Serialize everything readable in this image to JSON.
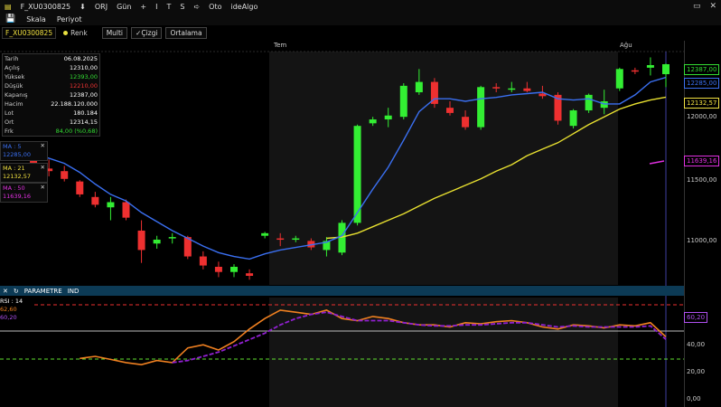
{
  "titlebar": {
    "symbol": "F_XU0300825",
    "buttons": [
      "ORJ",
      "Gün",
      "+",
      "I",
      "T",
      "S",
      "Oto",
      "ideAlgo"
    ],
    "arrow_down": "⬇",
    "arrow_right": "➪"
  },
  "menubar": {
    "items": [
      "Skala",
      "Periyot"
    ]
  },
  "toolbar": {
    "symbol": "F_XU0300825",
    "renk": "Renk",
    "multi": "Multi",
    "cizgi": "Çizgi",
    "ortalama": "Ortalama"
  },
  "timeaxis": {
    "tem": "Tem",
    "agu": "Ağu"
  },
  "info": {
    "rows": [
      {
        "k": "Tarih",
        "v": "06.08.2025",
        "color": "#ffffff"
      },
      {
        "k": "Açılış",
        "v": "12310,00",
        "color": "#ffffff"
      },
      {
        "k": "Yüksek",
        "v": "12393,00",
        "color": "#33dd33"
      },
      {
        "k": "Düşük",
        "v": "12210,00",
        "color": "#ee3333"
      },
      {
        "k": "Kapanış",
        "v": "12387,00",
        "color": "#ffffff"
      },
      {
        "k": "Hacim",
        "v": "22.188.120.000",
        "color": "#ffffff"
      },
      {
        "k": "Lot",
        "v": "180.184",
        "color": "#ffffff"
      },
      {
        "k": "Ort",
        "v": "12314,15",
        "color": "#ffffff"
      },
      {
        "k": "Frk",
        "v": "84,00 (%0,68)",
        "color": "#33dd33"
      }
    ]
  },
  "ma": [
    {
      "label": "MA : 5",
      "value": "12285,00",
      "color": "#3a6ff0"
    },
    {
      "label": "MA : 21",
      "value": "12132,57",
      "color": "#f0e040"
    },
    {
      "label": "MA : 50",
      "value": "11639,16",
      "color": "#e030e0"
    }
  ],
  "panelbar": {
    "parametre": "PARAMETRE",
    "ind": "IND"
  },
  "rsi": {
    "label": "RSI : 14",
    "v1": "62,60",
    "v2": "60,20"
  },
  "price_axis": [
    "12000,00",
    "11500,00",
    "11000,00"
  ],
  "rsi_axis": [
    "40,00",
    "20,00",
    "0,00"
  ],
  "price_tags": [
    {
      "text": "12387,00",
      "color": "#33dd33"
    },
    {
      "text": "12285,00",
      "color": "#3a6ff0"
    },
    {
      "text": "12132,57",
      "color": "#f0e040"
    },
    {
      "text": "11639,16",
      "color": "#e030e0"
    }
  ],
  "rsi_tag": "60,20",
  "chart_data": {
    "type": "candlestick",
    "x": [
      "d1",
      "d2",
      "d3",
      "d4",
      "d5",
      "d6",
      "d7",
      "d8",
      "d9",
      "d10",
      "d11",
      "d12",
      "d13",
      "d14",
      "d15",
      "d16",
      "d17",
      "d18",
      "d19",
      "d20",
      "d21",
      "d22",
      "d23",
      "d24",
      "d25",
      "d26",
      "d27",
      "d28",
      "d29",
      "d30",
      "d31",
      "d32",
      "d33",
      "d34",
      "d35",
      "d36",
      "d37",
      "d38",
      "d39",
      "d40",
      "d41",
      "d42",
      "d43"
    ],
    "ohlc": [
      [
        11700,
        11760,
        11650,
        11720
      ],
      [
        11680,
        11720,
        11560,
        11580
      ],
      [
        11580,
        11650,
        11520,
        11560
      ],
      [
        11560,
        11600,
        11480,
        11500
      ],
      [
        11480,
        11490,
        11360,
        11380
      ],
      [
        11360,
        11400,
        11280,
        11300
      ],
      [
        11280,
        11360,
        11180,
        11320
      ],
      [
        11320,
        11340,
        11180,
        11200
      ],
      [
        11100,
        11180,
        10850,
        10950
      ],
      [
        11000,
        11060,
        10960,
        11030
      ],
      [
        11040,
        11080,
        11000,
        11050
      ],
      [
        11050,
        11060,
        10880,
        10900
      ],
      [
        10900,
        10940,
        10800,
        10830
      ],
      [
        10820,
        10860,
        10740,
        10780
      ],
      [
        10780,
        10840,
        10740,
        10820
      ],
      [
        10770,
        10800,
        10720,
        10750
      ],
      [
        11060,
        11090,
        11040,
        11080
      ],
      [
        11040,
        11080,
        10980,
        11030
      ],
      [
        11030,
        11060,
        11010,
        11040
      ],
      [
        11020,
        11040,
        10950,
        10970
      ],
      [
        10950,
        11050,
        10900,
        11020
      ],
      [
        10930,
        11180,
        10910,
        11160
      ],
      [
        11160,
        11920,
        11140,
        11910
      ],
      [
        11930,
        11980,
        11910,
        11960
      ],
      [
        11960,
        12050,
        11900,
        11990
      ],
      [
        11980,
        12240,
        11960,
        12220
      ],
      [
        12170,
        12350,
        12150,
        12250
      ],
      [
        12250,
        12280,
        12050,
        12080
      ],
      [
        12050,
        12100,
        11990,
        12010
      ],
      [
        11980,
        12030,
        11880,
        11900
      ],
      [
        11900,
        12220,
        11880,
        12210
      ],
      [
        12210,
        12240,
        12170,
        12200
      ],
      [
        12200,
        12250,
        12170,
        12200
      ],
      [
        12200,
        12250,
        12170,
        12180
      ],
      [
        12160,
        12220,
        12120,
        12140
      ],
      [
        12150,
        12170,
        11920,
        11950
      ],
      [
        11910,
        12040,
        11890,
        12030
      ],
      [
        12030,
        12160,
        12010,
        12150
      ],
      [
        12050,
        12190,
        12000,
        12100
      ],
      [
        12200,
        12360,
        12180,
        12350
      ],
      [
        12340,
        12360,
        12310,
        12330
      ],
      [
        12360,
        12440,
        12300,
        12380
      ],
      [
        12310,
        12393,
        12210,
        12387
      ]
    ],
    "ma5": [
      11700,
      11690,
      11660,
      11620,
      11550,
      11460,
      11380,
      11330,
      11240,
      11170,
      11100,
      11040,
      10980,
      10930,
      10900,
      10880,
      10920,
      10950,
      10970,
      10990,
      11010,
      11060,
      11240,
      11420,
      11590,
      11800,
      12020,
      12120,
      12120,
      12100,
      12120,
      12130,
      12150,
      12160,
      12170,
      12120,
      12110,
      12120,
      12080,
      12080,
      12150,
      12250,
      12285
    ],
    "ma21": [
      null,
      null,
      null,
      null,
      null,
      null,
      null,
      null,
      null,
      null,
      null,
      null,
      null,
      null,
      null,
      null,
      null,
      null,
      null,
      null,
      11040,
      11050,
      11080,
      11130,
      11180,
      11230,
      11290,
      11350,
      11400,
      11450,
      11500,
      11560,
      11610,
      11680,
      11730,
      11780,
      11850,
      11920,
      11980,
      12040,
      12080,
      12110,
      12132.57
    ],
    "rsi14": [
      null,
      null,
      null,
      null,
      null,
      null,
      null,
      null,
      null,
      null,
      null,
      null,
      null,
      null,
      null,
      null,
      null,
      null,
      null,
      null,
      null,
      null,
      null,
      null,
      null,
      null,
      null,
      null,
      null,
      null,
      null,
      null,
      null,
      null,
      null,
      null,
      null,
      null,
      null,
      null,
      null,
      null,
      62.6
    ],
    "rsi_signal": 60.2,
    "ylim": [
      10750,
      12450
    ],
    "rsi_ylim": [
      0,
      100
    ],
    "rsi_levels": [
      70,
      30
    ]
  }
}
